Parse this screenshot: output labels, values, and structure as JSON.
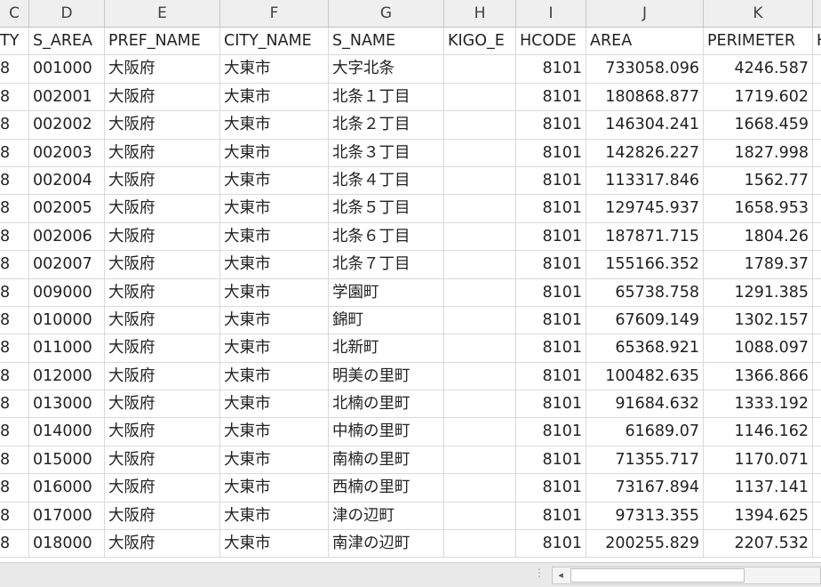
{
  "columns": [
    {
      "letter": "C",
      "field": "TY"
    },
    {
      "letter": "D",
      "field": "S_AREA"
    },
    {
      "letter": "E",
      "field": "PREF_NAME"
    },
    {
      "letter": "F",
      "field": "CITY_NAME"
    },
    {
      "letter": "G",
      "field": "S_NAME"
    },
    {
      "letter": "H",
      "field": "KIGO_E"
    },
    {
      "letter": "I",
      "field": "HCODE"
    },
    {
      "letter": "J",
      "field": "AREA"
    },
    {
      "letter": "K",
      "field": "PERIMETER"
    },
    {
      "letter": "",
      "field": "H"
    }
  ],
  "rows": [
    [
      "8",
      "001000",
      "大阪府",
      "大東市",
      "大字北条",
      "",
      "8101",
      "733058.096",
      "4246.587"
    ],
    [
      "8",
      "002001",
      "大阪府",
      "大東市",
      "北条１丁目",
      "",
      "8101",
      "180868.877",
      "1719.602"
    ],
    [
      "8",
      "002002",
      "大阪府",
      "大東市",
      "北条２丁目",
      "",
      "8101",
      "146304.241",
      "1668.459"
    ],
    [
      "8",
      "002003",
      "大阪府",
      "大東市",
      "北条３丁目",
      "",
      "8101",
      "142826.227",
      "1827.998"
    ],
    [
      "8",
      "002004",
      "大阪府",
      "大東市",
      "北条４丁目",
      "",
      "8101",
      "113317.846",
      "1562.77"
    ],
    [
      "8",
      "002005",
      "大阪府",
      "大東市",
      "北条５丁目",
      "",
      "8101",
      "129745.937",
      "1658.953"
    ],
    [
      "8",
      "002006",
      "大阪府",
      "大東市",
      "北条６丁目",
      "",
      "8101",
      "187871.715",
      "1804.26"
    ],
    [
      "8",
      "002007",
      "大阪府",
      "大東市",
      "北条７丁目",
      "",
      "8101",
      "155166.352",
      "1789.37"
    ],
    [
      "8",
      "009000",
      "大阪府",
      "大東市",
      "学園町",
      "",
      "8101",
      "65738.758",
      "1291.385"
    ],
    [
      "8",
      "010000",
      "大阪府",
      "大東市",
      "錦町",
      "",
      "8101",
      "67609.149",
      "1302.157"
    ],
    [
      "8",
      "011000",
      "大阪府",
      "大東市",
      "北新町",
      "",
      "8101",
      "65368.921",
      "1088.097"
    ],
    [
      "8",
      "012000",
      "大阪府",
      "大東市",
      "明美の里町",
      "",
      "8101",
      "100482.635",
      "1366.866"
    ],
    [
      "8",
      "013000",
      "大阪府",
      "大東市",
      "北楠の里町",
      "",
      "8101",
      "91684.632",
      "1333.192"
    ],
    [
      "8",
      "014000",
      "大阪府",
      "大東市",
      "中楠の里町",
      "",
      "8101",
      "61689.07",
      "1146.162"
    ],
    [
      "8",
      "015000",
      "大阪府",
      "大東市",
      "南楠の里町",
      "",
      "8101",
      "71355.717",
      "1170.071"
    ],
    [
      "8",
      "016000",
      "大阪府",
      "大東市",
      "西楠の里町",
      "",
      "8101",
      "73167.894",
      "1137.141"
    ],
    [
      "8",
      "017000",
      "大阪府",
      "大東市",
      "津の辺町",
      "",
      "8101",
      "97313.355",
      "1394.625"
    ],
    [
      "8",
      "018000",
      "大阪府",
      "大東市",
      "南津の辺町",
      "",
      "8101",
      "200255.829",
      "2207.532"
    ]
  ],
  "scrollbar": {
    "left_arrow": "◂",
    "grip": "⋮"
  }
}
